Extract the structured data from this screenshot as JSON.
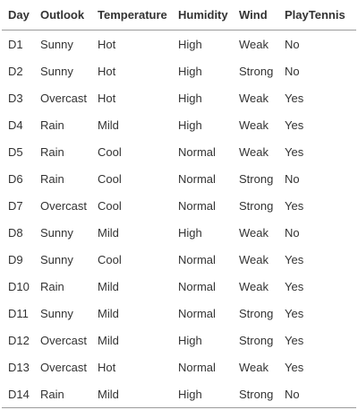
{
  "table": {
    "columns": [
      "Day",
      "Outlook",
      "Temperature",
      "Humidity",
      "Wind",
      "PlayTennis"
    ],
    "rows": [
      [
        "D1",
        "Sunny",
        "Hot",
        "High",
        "Weak",
        "No"
      ],
      [
        "D2",
        "Sunny",
        "Hot",
        "High",
        "Strong",
        "No"
      ],
      [
        "D3",
        "Overcast",
        "Hot",
        "High",
        "Weak",
        "Yes"
      ],
      [
        "D4",
        "Rain",
        "Mild",
        "High",
        "Weak",
        "Yes"
      ],
      [
        "D5",
        "Rain",
        "Cool",
        "Normal",
        "Weak",
        "Yes"
      ],
      [
        "D6",
        "Rain",
        "Cool",
        "Normal",
        "Strong",
        "No"
      ],
      [
        "D7",
        "Overcast",
        "Cool",
        "Normal",
        "Strong",
        "Yes"
      ],
      [
        "D8",
        "Sunny",
        "Mild",
        "High",
        "Weak",
        "No"
      ],
      [
        "D9",
        "Sunny",
        "Cool",
        "Normal",
        "Weak",
        "Yes"
      ],
      [
        "D10",
        "Rain",
        "Mild",
        "Normal",
        "Weak",
        "Yes"
      ],
      [
        "D11",
        "Sunny",
        "Mild",
        "Normal",
        "Strong",
        "Yes"
      ],
      [
        "D12",
        "Overcast",
        "Mild",
        "High",
        "Strong",
        "Yes"
      ],
      [
        "D13",
        "Overcast",
        "Hot",
        "Normal",
        "Weak",
        "Yes"
      ],
      [
        "D14",
        "Rain",
        "Mild",
        "High",
        "Strong",
        "No"
      ]
    ]
  }
}
